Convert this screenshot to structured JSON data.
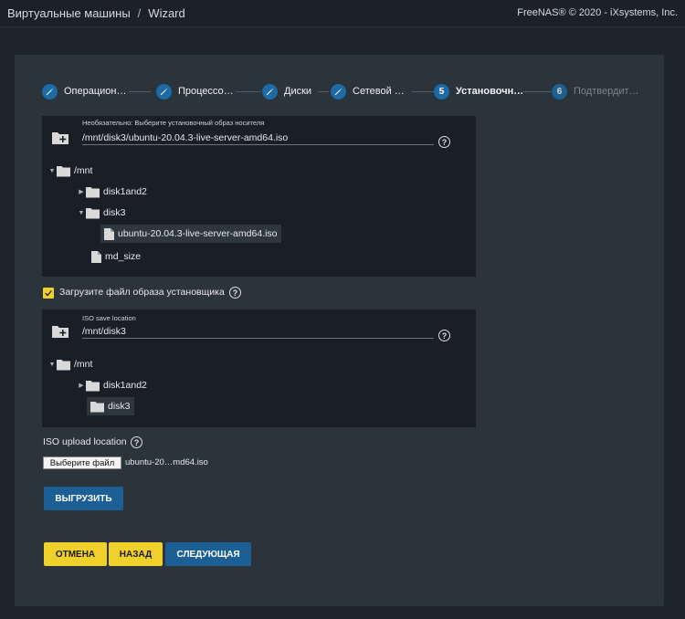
{
  "header": {
    "breadcrumb_root": "Виртуальные машины",
    "breadcrumb_sep": "/",
    "breadcrumb_current": "Wizard",
    "brand": "FreeNAS® © 2020 - iXsystems, Inc."
  },
  "steps": [
    {
      "icon": "pencil-icon",
      "label": "Операцион…",
      "state": "done"
    },
    {
      "icon": "pencil-icon",
      "label": "Процессо…",
      "state": "done"
    },
    {
      "icon": "pencil-icon",
      "label": "Диски",
      "state": "done"
    },
    {
      "icon": "pencil-icon",
      "label": "Сетевой …",
      "state": "done"
    },
    {
      "number": "5",
      "label": "Установочн…",
      "state": "active"
    },
    {
      "number": "6",
      "label": "Подтвердит…",
      "state": "pending"
    }
  ],
  "install_media": {
    "hint": "Необязательно: Выберите установочный образ носителя",
    "value": "/mnt/disk3/ubuntu-20.04.3-live-server-amd64.iso",
    "help": "?",
    "tree": {
      "root": "/mnt",
      "disk1": "disk1and2",
      "disk3": "disk3",
      "iso_file": "ubuntu-20.04.3-live-server-amd64.iso",
      "md_size": "md_size"
    }
  },
  "upload_checkbox": {
    "label": "Загрузите файл образа установщика",
    "checked": true,
    "help": "?"
  },
  "iso_save": {
    "hint": "ISO save location",
    "value": "/mnt/disk3",
    "help": "?",
    "tree": {
      "root": "/mnt",
      "disk1": "disk1and2",
      "disk3": "disk3"
    }
  },
  "iso_upload": {
    "label": "ISO upload location",
    "help": "?",
    "file_button": "Выберите файл",
    "file_name": "ubuntu-20…md64.iso",
    "upload_button": "ВЫГРУЗИТЬ"
  },
  "actions": {
    "cancel": "ОТМЕНА",
    "back": "НАЗАД",
    "next": "СЛЕДУЮЩАЯ"
  },
  "colors": {
    "accent_blue": "#1c5f94",
    "accent_yellow": "#f0d12c",
    "card_bg": "#2b343b",
    "panel_bg": "#1a1f25"
  }
}
